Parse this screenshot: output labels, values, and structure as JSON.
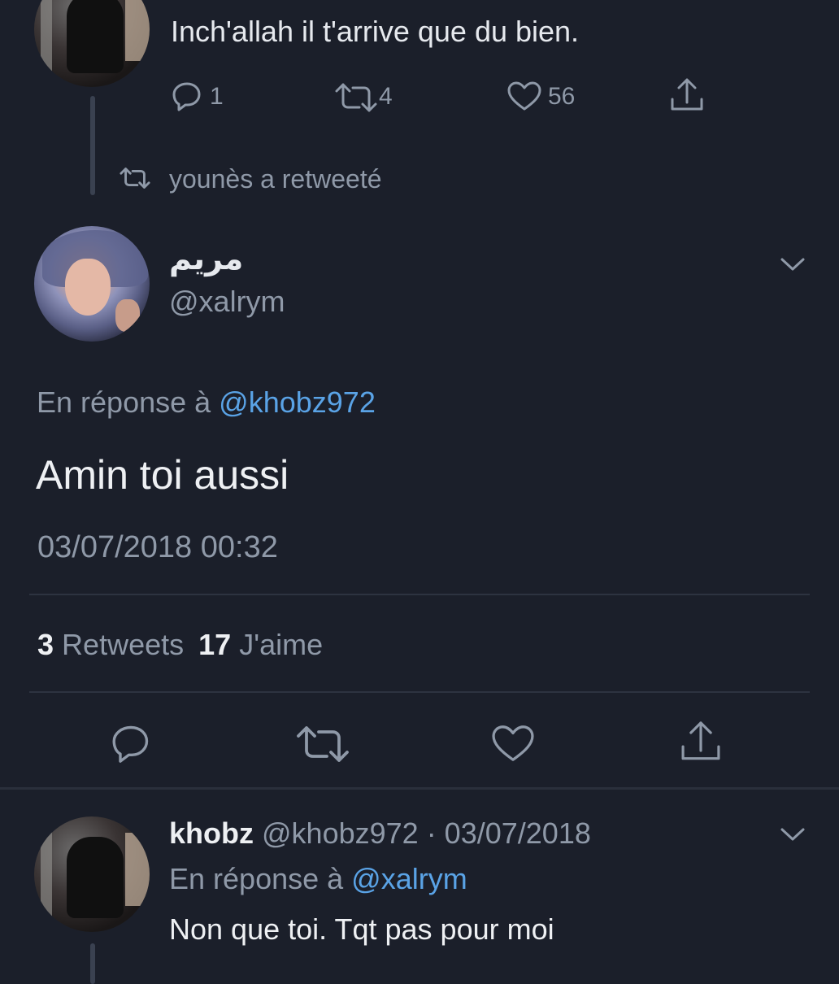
{
  "previous_tweet": {
    "text": "Inch'allah il t'arrive que du bien.",
    "reply_count": "1",
    "retweet_count": "4",
    "like_count": "56"
  },
  "retweet_banner": {
    "label": "younès a retweeté"
  },
  "main_tweet": {
    "display_name": "مريم",
    "handle": "@xalrym",
    "reply_prefix": "En réponse à",
    "reply_to": "@khobz972",
    "text": "Amin toi aussi",
    "timestamp": "03/07/2018 00:32",
    "stats": {
      "retweets_count": "3",
      "retweets_label": "Retweets",
      "likes_count": "17",
      "likes_label": "J'aime"
    }
  },
  "reply_tweet": {
    "display_name": "khobz",
    "handle_and_date": "@khobz972 · 03/07/2018",
    "reply_prefix": "En réponse à",
    "reply_to": "@xalrym",
    "text": "Non que toi. Tqt pas pour moi"
  },
  "icons": {
    "reply": "reply-icon",
    "retweet": "retweet-icon",
    "like": "heart-icon",
    "share": "share-icon",
    "more": "chevron-down-icon"
  },
  "colors": {
    "background": "#1b1f2a",
    "text": "#e6e9ee",
    "muted": "#8f99a8",
    "link": "#5aa3e6"
  }
}
